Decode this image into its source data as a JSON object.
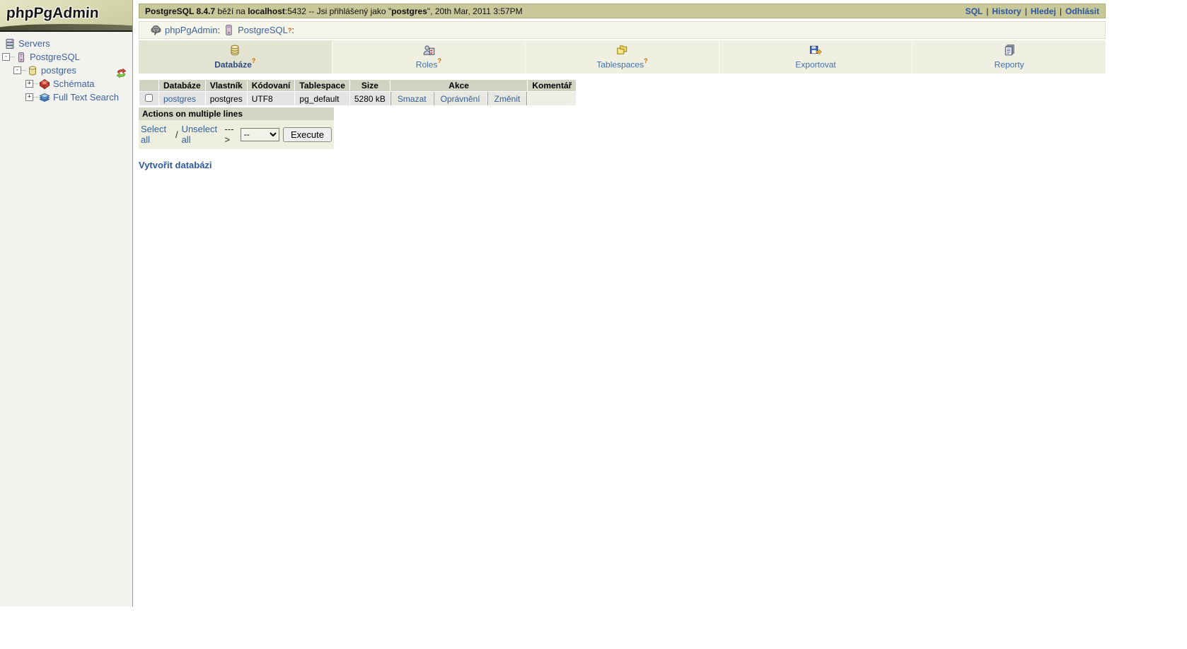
{
  "logo": {
    "text": "phpPgAdmin"
  },
  "sidebar": {
    "tree": [
      {
        "label": "Servers",
        "icon": "servers-icon",
        "expander": ""
      },
      {
        "label": "PostgreSQL",
        "icon": "server-icon",
        "expander": "-"
      },
      {
        "label": "postgres",
        "icon": "database-icon",
        "expander": "-"
      },
      {
        "label": "Schémata",
        "icon": "schemas-icon",
        "expander": "+"
      },
      {
        "label": "Full Text Search",
        "icon": "fts-icon",
        "expander": "+"
      }
    ]
  },
  "topbar": {
    "version": "PostgreSQL 8.4.7",
    "text_before_host": " běží na ",
    "host": "localhost",
    "text_after_host": ":5432 -- Jsi přihlášený jako \"",
    "user": "postgres",
    "text_after_user": "\", 20th Mar, 2011 3:57PM",
    "sep": "|",
    "links": {
      "sql": "SQL",
      "history": "History",
      "search": "Hledej",
      "logout": "Odhlásit"
    }
  },
  "breadcrumb": {
    "app": "phpPgAdmin",
    "colon": ":",
    "server": "PostgreSQL",
    "help": "?",
    "colon2": ":"
  },
  "tabs": {
    "items": [
      {
        "label": "Databáze",
        "help": "?",
        "icon": "databases-icon"
      },
      {
        "label": "Roles",
        "help": "?",
        "icon": "roles-icon"
      },
      {
        "label": "Tablespaces",
        "help": "?",
        "icon": "tablespaces-icon"
      },
      {
        "label": "Exportovat",
        "help": "",
        "icon": "export-icon"
      },
      {
        "label": "Reporty",
        "help": "",
        "icon": "reports-icon"
      }
    ]
  },
  "table": {
    "headers": {
      "database": "Databáze",
      "owner": "Vlastník",
      "encoding": "Kódovaní",
      "tablespace": "Tablespace",
      "size": "Size",
      "actions": "Akce",
      "comment": "Komentář"
    },
    "rows": [
      {
        "database": "postgres",
        "owner": "postgres",
        "encoding": "UTF8",
        "tablespace": "pg_default",
        "size": "5280 kB",
        "action_delete": "Smazat",
        "action_privileges": "Oprávnění",
        "action_alter": "Změnit",
        "comment": ""
      }
    ]
  },
  "multi": {
    "title": "Actions on multiple lines",
    "select_all": "Select all",
    "slash": "/",
    "unselect_all": "Unselect all",
    "arrow": "--->",
    "dropdown_value": "--",
    "execute": "Execute"
  },
  "footer_links": {
    "create_database": "Vytvořit databázi"
  },
  "colors": {
    "topbar_bg": "#c8c89b",
    "tab_active_bg": "#e3e3d2",
    "tab_bg": "#f0f0e2",
    "header_bg": "#d2d2c2",
    "row_bg": "#e4e4e4",
    "link": "#31609c",
    "help": "#cc6600"
  }
}
